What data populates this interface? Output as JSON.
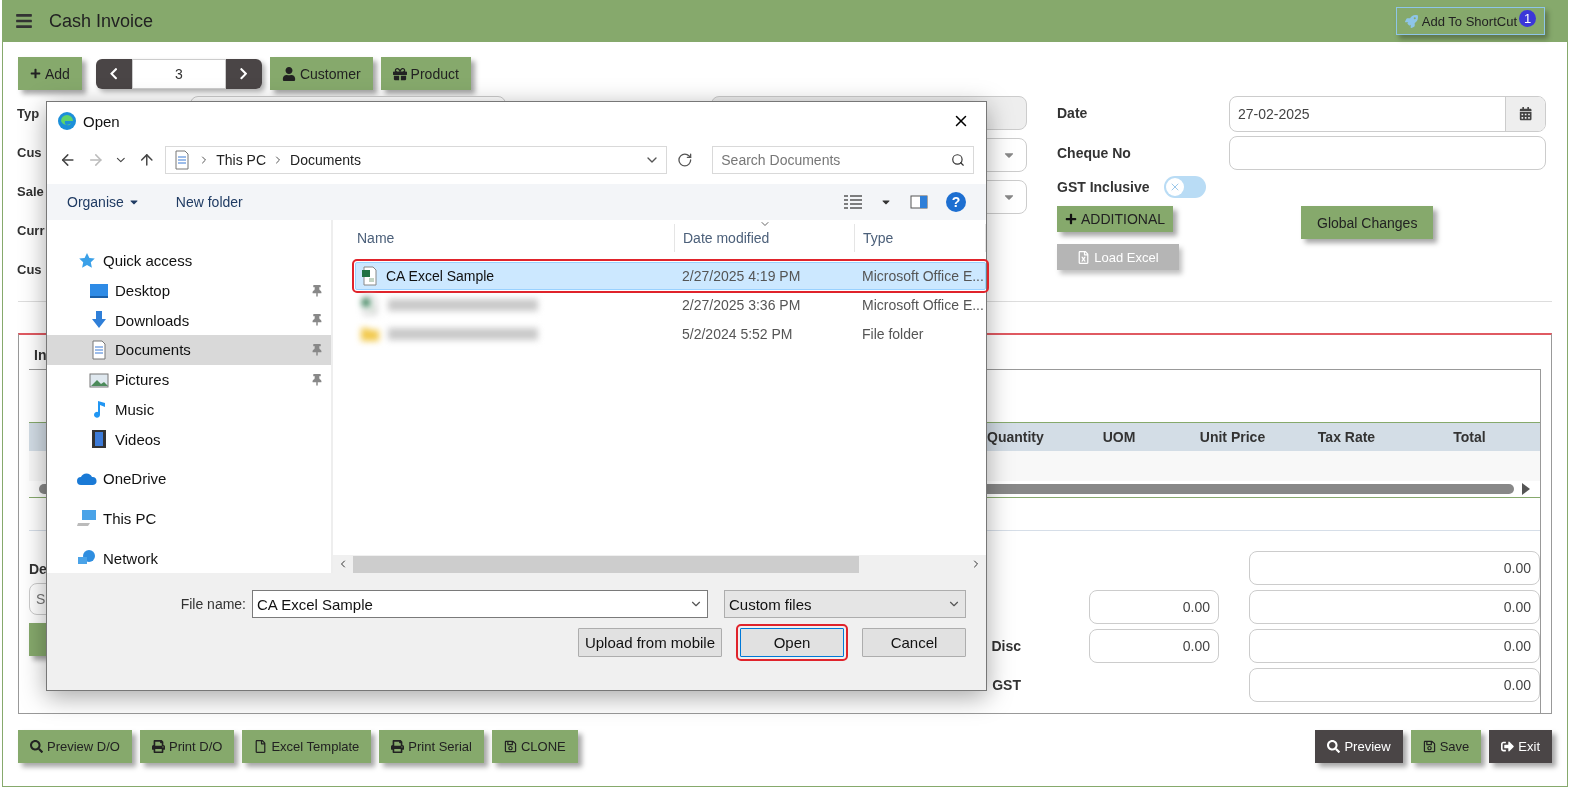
{
  "header": {
    "title": "Cash Invoice",
    "shortcut_button": "Add To ShortCut",
    "shortcut_badge": "1"
  },
  "toolbar": {
    "add_button": "Add",
    "record_number": "3",
    "buttons": [
      {
        "label": "Customer",
        "kind": "customer"
      },
      {
        "label": "Product",
        "kind": "product"
      }
    ]
  },
  "form_labels": [
    "Typ",
    "Cus",
    "Sale",
    "Curr",
    "Cus"
  ],
  "right_form": {
    "date_label": "Date",
    "date_value": "27-02-2025",
    "cheque_label": "Cheque No",
    "gst_label": "GST Inclusive",
    "gst_inclusive": false,
    "additional_button": "ADDITIONAL",
    "global_changes_button": "Global Changes",
    "load_excel_button": "Load Excel",
    "load_excel_disabled": true
  },
  "tab_label": "In",
  "item_table": {
    "columns": [
      "Quantity",
      "UOM",
      "Unit Price",
      "Tax Rate",
      "Total"
    ]
  },
  "details_label": "De",
  "search_placeholder": "S",
  "totals": [
    {
      "amount": "0.00"
    },
    {
      "discount": "0.00",
      "amount": "0.00"
    },
    {
      "label": "Disc",
      "discount": "0.00",
      "amount": "0.00"
    },
    {
      "label": "GST",
      "amount": "0.00"
    }
  ],
  "footer_left": [
    {
      "label": "Preview D/O",
      "kind": "search"
    },
    {
      "label": "Print D/O",
      "kind": "print"
    },
    {
      "label": "Excel Template",
      "kind": "file"
    },
    {
      "label": "Print Serial",
      "kind": "print"
    },
    {
      "label": "CLONE",
      "kind": "save"
    }
  ],
  "footer_right": [
    {
      "label": "Preview",
      "kind": "search"
    },
    {
      "label": "Save",
      "kind": "save"
    },
    {
      "label": "Exit",
      "kind": "exit"
    }
  ],
  "dialog": {
    "title": "Open",
    "path": [
      "This PC",
      "Documents"
    ],
    "search_placeholder": "Search Documents",
    "organise": "Organise",
    "new_folder": "New folder",
    "help": "?",
    "nav": [
      {
        "label": "Quick access",
        "kind": "star",
        "selected": false,
        "children": [
          {
            "label": "Desktop",
            "kind": "desktop",
            "pinned": true,
            "selected": false
          },
          {
            "label": "Downloads",
            "kind": "download",
            "pinned": true,
            "selected": false
          },
          {
            "label": "Documents",
            "kind": "document",
            "pinned": true,
            "selected": true
          },
          {
            "label": "Pictures",
            "kind": "picture",
            "pinned": true,
            "selected": false
          },
          {
            "label": "Music",
            "kind": "music",
            "pinned": false,
            "selected": false
          },
          {
            "label": "Videos",
            "kind": "video",
            "pinned": false,
            "selected": false
          }
        ]
      },
      {
        "label": "OneDrive",
        "kind": "cloud",
        "selected": false
      },
      {
        "label": "This PC",
        "kind": "computer",
        "selected": false
      },
      {
        "label": "Network",
        "kind": "network",
        "selected": false
      }
    ],
    "columns": [
      "Name",
      "Date modified",
      "Type"
    ],
    "files": [
      {
        "name": "CA Excel Sample",
        "date": "2/27/2025 4:19 PM",
        "type": "Microsoft Office E...",
        "kind": "excel",
        "selected": true
      },
      {
        "date": "2/27/2025 3:36 PM",
        "type": "Microsoft Office E...",
        "kind": "excel",
        "selected": false
      },
      {
        "date": "5/2/2024 5:52 PM",
        "type": "File folder",
        "kind": "folder",
        "selected": false
      }
    ],
    "file_name_label": "File name:",
    "file_name_value": "CA Excel Sample",
    "file_type": "Custom files",
    "buttons": [
      {
        "label": "Upload from mobile",
        "highlighted": false
      },
      {
        "label": "Open",
        "highlighted": true
      },
      {
        "label": "Cancel",
        "highlighted": false
      }
    ]
  }
}
